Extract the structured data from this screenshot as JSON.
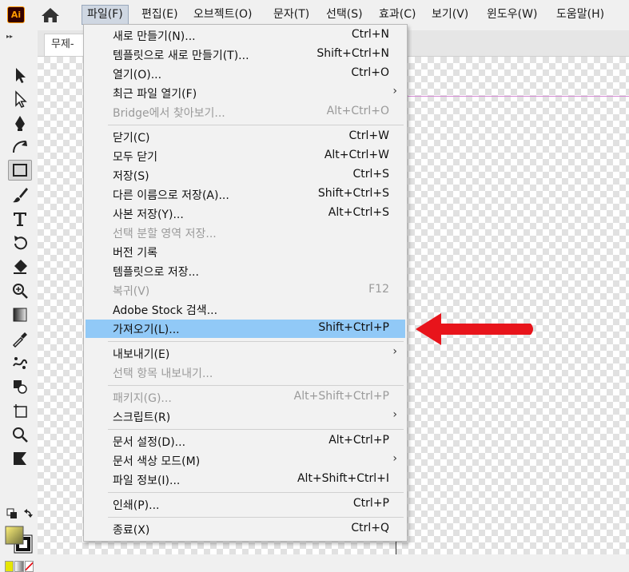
{
  "app": {
    "logo_text": "Ai"
  },
  "menubar": {
    "items": [
      {
        "label": "파일(F)"
      },
      {
        "label": "편집(E)"
      },
      {
        "label": "오브젝트(O)"
      },
      {
        "label": "문자(T)"
      },
      {
        "label": "선택(S)"
      },
      {
        "label": "효과(C)"
      },
      {
        "label": "보기(V)"
      },
      {
        "label": "윈도우(W)"
      },
      {
        "label": "도움말(H)"
      }
    ]
  },
  "document": {
    "tab_title": "무제-"
  },
  "file_menu": {
    "items": [
      {
        "label": "새로 만들기(N)...",
        "shortcut": "Ctrl+N"
      },
      {
        "label": "템플릿으로 새로 만들기(T)...",
        "shortcut": "Shift+Ctrl+N"
      },
      {
        "label": "열기(O)...",
        "shortcut": "Ctrl+O"
      },
      {
        "label": "최근 파일 열기(F)",
        "shortcut": ""
      },
      {
        "label": "Bridge에서 찾아보기...",
        "shortcut": "Alt+Ctrl+O"
      },
      {
        "label": "닫기(C)",
        "shortcut": "Ctrl+W"
      },
      {
        "label": "모두 닫기",
        "shortcut": "Alt+Ctrl+W"
      },
      {
        "label": "저장(S)",
        "shortcut": "Ctrl+S"
      },
      {
        "label": "다른 이름으로 저장(A)...",
        "shortcut": "Shift+Ctrl+S"
      },
      {
        "label": "사본 저장(Y)...",
        "shortcut": "Alt+Ctrl+S"
      },
      {
        "label": "선택 분할 영역 저장...",
        "shortcut": ""
      },
      {
        "label": "버전 기록",
        "shortcut": ""
      },
      {
        "label": "템플릿으로 저장...",
        "shortcut": ""
      },
      {
        "label": "복귀(V)",
        "shortcut": "F12"
      },
      {
        "label": "Adobe Stock 검색...",
        "shortcut": ""
      },
      {
        "label": "가져오기(L)...",
        "shortcut": "Shift+Ctrl+P"
      },
      {
        "label": "내보내기(E)",
        "shortcut": ""
      },
      {
        "label": "선택 항목 내보내기...",
        "shortcut": ""
      },
      {
        "label": "패키지(G)...",
        "shortcut": "Alt+Shift+Ctrl+P"
      },
      {
        "label": "스크립트(R)",
        "shortcut": ""
      },
      {
        "label": "문서 설정(D)...",
        "shortcut": "Alt+Ctrl+P"
      },
      {
        "label": "문서 색상 모드(M)",
        "shortcut": ""
      },
      {
        "label": "파일 정보(I)...",
        "shortcut": "Alt+Shift+Ctrl+I"
      },
      {
        "label": "인쇄(P)...",
        "shortcut": "Ctrl+P"
      },
      {
        "label": "종료(X)",
        "shortcut": "Ctrl+Q"
      }
    ],
    "submenu_arrow": "›"
  },
  "colors": {
    "highlight": "#91c9f7",
    "callout_arrow": "#e8141b",
    "app_logo": "#ff9a00"
  }
}
